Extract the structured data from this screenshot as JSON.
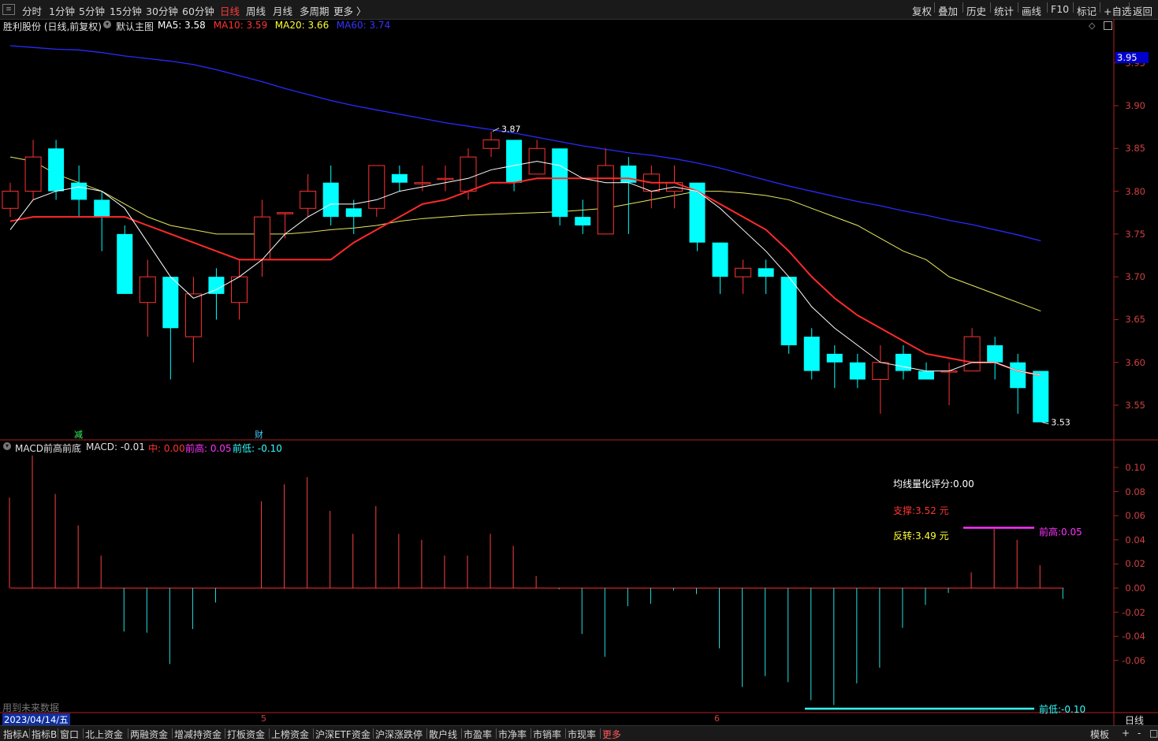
{
  "toolbar": {
    "left_items": [
      "分时",
      "1分钟",
      "5分钟",
      "15分钟",
      "30分钟",
      "60分钟",
      "日线",
      "周线",
      "月线",
      "多周期",
      "更多 〉"
    ],
    "active": "日线",
    "right_items": [
      "复权",
      "叠加",
      "历史",
      "统计",
      "画线",
      "F10",
      "标记",
      "+自选",
      "返回"
    ]
  },
  "main_chart": {
    "title": "胜利股份 (日线,前复权)",
    "template": "默认主图",
    "ma": [
      {
        "label": "MA5: 3.58",
        "color": "#ffffff"
      },
      {
        "label": "MA10: 3.59",
        "color": "#ff3333"
      },
      {
        "label": "MA20: 3.66",
        "color": "#ffff33"
      },
      {
        "label": "MA60: 3.74",
        "color": "#3333ff"
      }
    ],
    "price_axis": [
      "3.95",
      "3.90",
      "3.85",
      "3.80",
      "3.75",
      "3.70",
      "3.65",
      "3.60",
      "3.55"
    ],
    "high_marker": "3.87",
    "low_marker": "3.53",
    "current_price_tag": "3.95",
    "event_labels": [
      "减",
      "财"
    ]
  },
  "chart_data": {
    "type": "candlestick",
    "ylim": [
      3.52,
      3.98
    ],
    "candles": [
      {
        "o": 3.78,
        "c": 3.8,
        "h": 3.81,
        "l": 3.77
      },
      {
        "o": 3.8,
        "c": 3.84,
        "h": 3.86,
        "l": 3.79
      },
      {
        "o": 3.85,
        "c": 3.8,
        "h": 3.86,
        "l": 3.79
      },
      {
        "o": 3.81,
        "c": 3.79,
        "h": 3.83,
        "l": 3.77
      },
      {
        "o": 3.79,
        "c": 3.77,
        "h": 3.8,
        "l": 3.73
      },
      {
        "o": 3.75,
        "c": 3.68,
        "h": 3.76,
        "l": 3.68
      },
      {
        "o": 3.67,
        "c": 3.7,
        "h": 3.72,
        "l": 3.63
      },
      {
        "o": 3.7,
        "c": 3.64,
        "h": 3.7,
        "l": 3.58
      },
      {
        "o": 3.63,
        "c": 3.68,
        "h": 3.7,
        "l": 3.6
      },
      {
        "o": 3.7,
        "c": 3.68,
        "h": 3.71,
        "l": 3.65
      },
      {
        "o": 3.67,
        "c": 3.7,
        "h": 3.72,
        "l": 3.65
      },
      {
        "o": 3.72,
        "c": 3.77,
        "h": 3.79,
        "l": 3.7
      },
      {
        "o": 3.775,
        "c": 3.775,
        "h": 3.775,
        "l": 3.745
      },
      {
        "o": 3.78,
        "c": 3.8,
        "h": 3.82,
        "l": 3.77
      },
      {
        "o": 3.81,
        "c": 3.77,
        "h": 3.83,
        "l": 3.76
      },
      {
        "o": 3.78,
        "c": 3.77,
        "h": 3.79,
        "l": 3.75
      },
      {
        "o": 3.78,
        "c": 3.83,
        "h": 3.83,
        "l": 3.77
      },
      {
        "o": 3.82,
        "c": 3.81,
        "h": 3.83,
        "l": 3.8
      },
      {
        "o": 3.81,
        "c": 3.81,
        "h": 3.83,
        "l": 3.8
      },
      {
        "o": 3.815,
        "c": 3.815,
        "h": 3.83,
        "l": 3.8
      },
      {
        "o": 3.8,
        "c": 3.84,
        "h": 3.85,
        "l": 3.79
      },
      {
        "o": 3.85,
        "c": 3.86,
        "h": 3.87,
        "l": 3.84
      },
      {
        "o": 3.86,
        "c": 3.81,
        "h": 3.86,
        "l": 3.8
      },
      {
        "o": 3.82,
        "c": 3.85,
        "h": 3.86,
        "l": 3.82
      },
      {
        "o": 3.85,
        "c": 3.77,
        "h": 3.85,
        "l": 3.76
      },
      {
        "o": 3.77,
        "c": 3.76,
        "h": 3.79,
        "l": 3.75
      },
      {
        "o": 3.75,
        "c": 3.83,
        "h": 3.85,
        "l": 3.75
      },
      {
        "o": 3.83,
        "c": 3.81,
        "h": 3.84,
        "l": 3.75
      },
      {
        "o": 3.8,
        "c": 3.82,
        "h": 3.83,
        "l": 3.78
      },
      {
        "o": 3.8,
        "c": 3.81,
        "h": 3.83,
        "l": 3.78
      },
      {
        "o": 3.81,
        "c": 3.74,
        "h": 3.81,
        "l": 3.73
      },
      {
        "o": 3.74,
        "c": 3.7,
        "h": 3.74,
        "l": 3.68
      },
      {
        "o": 3.7,
        "c": 3.71,
        "h": 3.72,
        "l": 3.68
      },
      {
        "o": 3.71,
        "c": 3.7,
        "h": 3.72,
        "l": 3.68
      },
      {
        "o": 3.7,
        "c": 3.62,
        "h": 3.7,
        "l": 3.61
      },
      {
        "o": 3.63,
        "c": 3.59,
        "h": 3.64,
        "l": 3.58
      },
      {
        "o": 3.61,
        "c": 3.6,
        "h": 3.62,
        "l": 3.57
      },
      {
        "o": 3.6,
        "c": 3.58,
        "h": 3.61,
        "l": 3.57
      },
      {
        "o": 3.58,
        "c": 3.6,
        "h": 3.62,
        "l": 3.54
      },
      {
        "o": 3.61,
        "c": 3.59,
        "h": 3.62,
        "l": 3.58
      },
      {
        "o": 3.59,
        "c": 3.58,
        "h": 3.6,
        "l": 3.58
      },
      {
        "o": 3.59,
        "c": 3.59,
        "h": 3.6,
        "l": 3.55
      },
      {
        "o": 3.59,
        "c": 3.63,
        "h": 3.64,
        "l": 3.59
      },
      {
        "o": 3.62,
        "c": 3.6,
        "h": 3.63,
        "l": 3.58
      },
      {
        "o": 3.6,
        "c": 3.57,
        "h": 3.61,
        "l": 3.54
      },
      {
        "o": 3.59,
        "c": 3.53,
        "h": 3.59,
        "l": 3.53
      }
    ],
    "ma5": [
      3.755,
      3.79,
      3.8,
      3.805,
      3.8,
      3.78,
      3.74,
      3.7,
      3.675,
      3.685,
      3.7,
      3.72,
      3.75,
      3.77,
      3.785,
      3.785,
      3.79,
      3.8,
      3.805,
      3.81,
      3.815,
      3.825,
      3.83,
      3.835,
      3.83,
      3.815,
      3.81,
      3.81,
      3.8,
      3.805,
      3.8,
      3.78,
      3.755,
      3.73,
      3.7,
      3.665,
      3.64,
      3.62,
      3.6,
      3.595,
      3.59,
      3.59,
      3.6,
      3.6,
      3.59,
      3.585
    ],
    "ma10": [
      3.765,
      3.77,
      3.77,
      3.77,
      3.77,
      3.77,
      3.76,
      3.75,
      3.74,
      3.73,
      3.72,
      3.72,
      3.72,
      3.72,
      3.72,
      3.74,
      3.755,
      3.77,
      3.785,
      3.79,
      3.8,
      3.81,
      3.81,
      3.815,
      3.815,
      3.815,
      3.815,
      3.815,
      3.81,
      3.81,
      3.8,
      3.785,
      3.77,
      3.755,
      3.73,
      3.7,
      3.675,
      3.655,
      3.64,
      3.625,
      3.61,
      3.605,
      3.6,
      3.6,
      3.59,
      3.585
    ],
    "ma20": [
      3.84,
      3.835,
      3.82,
      3.81,
      3.8,
      3.785,
      3.77,
      3.76,
      3.755,
      3.75,
      3.75,
      3.75,
      3.75,
      3.752,
      3.755,
      3.757,
      3.76,
      3.765,
      3.768,
      3.77,
      3.772,
      3.773,
      3.774,
      3.775,
      3.776,
      3.778,
      3.78,
      3.785,
      3.79,
      3.795,
      3.8,
      3.8,
      3.798,
      3.795,
      3.79,
      3.78,
      3.77,
      3.76,
      3.745,
      3.73,
      3.72,
      3.7,
      3.69,
      3.68,
      3.67,
      3.66
    ],
    "ma60": [
      3.97,
      3.968,
      3.966,
      3.965,
      3.962,
      3.958,
      3.955,
      3.952,
      3.948,
      3.942,
      3.935,
      3.928,
      3.92,
      3.913,
      3.906,
      3.9,
      3.895,
      3.89,
      3.885,
      3.88,
      3.876,
      3.872,
      3.868,
      3.863,
      3.858,
      3.853,
      3.849,
      3.845,
      3.842,
      3.838,
      3.833,
      3.827,
      3.82,
      3.813,
      3.806,
      3.8,
      3.794,
      3.788,
      3.783,
      3.777,
      3.772,
      3.766,
      3.761,
      3.755,
      3.749,
      3.742
    ]
  },
  "macd_chart": {
    "title": "MACD前高前底",
    "macd_label": "MACD: -0.01",
    "zhong_label": "中: 0.00",
    "qiangao_label": "前高: 0.05",
    "qiandi_label": "前低: -0.10",
    "axis": [
      "0.10",
      "0.08",
      "0.06",
      "0.04",
      "0.02",
      "0.00",
      "-0.02",
      "-0.04",
      "-0.06"
    ],
    "ylim": [
      -0.105,
      0.11
    ],
    "values": [
      0.075,
      0.11,
      0.078,
      0.052,
      0.027,
      -0.036,
      -0.037,
      -0.063,
      -0.034,
      -0.012,
      0.0,
      0.072,
      0.086,
      0.092,
      0.064,
      0.045,
      0.068,
      0.045,
      0.04,
      0.027,
      0.027,
      0.045,
      0.035,
      0.01,
      -0.001,
      -0.038,
      -0.057,
      -0.015,
      -0.013,
      -0.002,
      -0.005,
      -0.05,
      -0.082,
      -0.073,
      -0.078,
      -0.093,
      -0.097,
      -0.079,
      -0.066,
      -0.033,
      -0.014,
      -0.004,
      0.013,
      0.049,
      0.04,
      0.019,
      -0.009
    ],
    "score_text": "均线量化评分:0.00",
    "support_text": "支撑:3.52 元",
    "reversal_text": "反转:3.49 元",
    "front_high_text": "前高:0.05",
    "front_low_text": "前低:-0.10"
  },
  "footer": {
    "future_data_text": "用到未来数据",
    "date_label": "2023/04/14/五",
    "month_ticks": [
      "5",
      "6"
    ],
    "period_label": "日线"
  },
  "bottom_tabs": [
    "指标A",
    "指标B",
    "窗口",
    "北上资金",
    "两融资金",
    "增减持资金",
    "打板资金",
    "上榜资金",
    "沪深ETF资金",
    "沪深涨跌停",
    "散户线",
    "市盈率",
    "市净率",
    "市销率",
    "市现率",
    "更多"
  ],
  "bottom_right": [
    "模板",
    "+",
    "-",
    "□"
  ],
  "colors": {
    "up": "#ff3232",
    "down": "#00ffff",
    "axis": "#b02020"
  }
}
